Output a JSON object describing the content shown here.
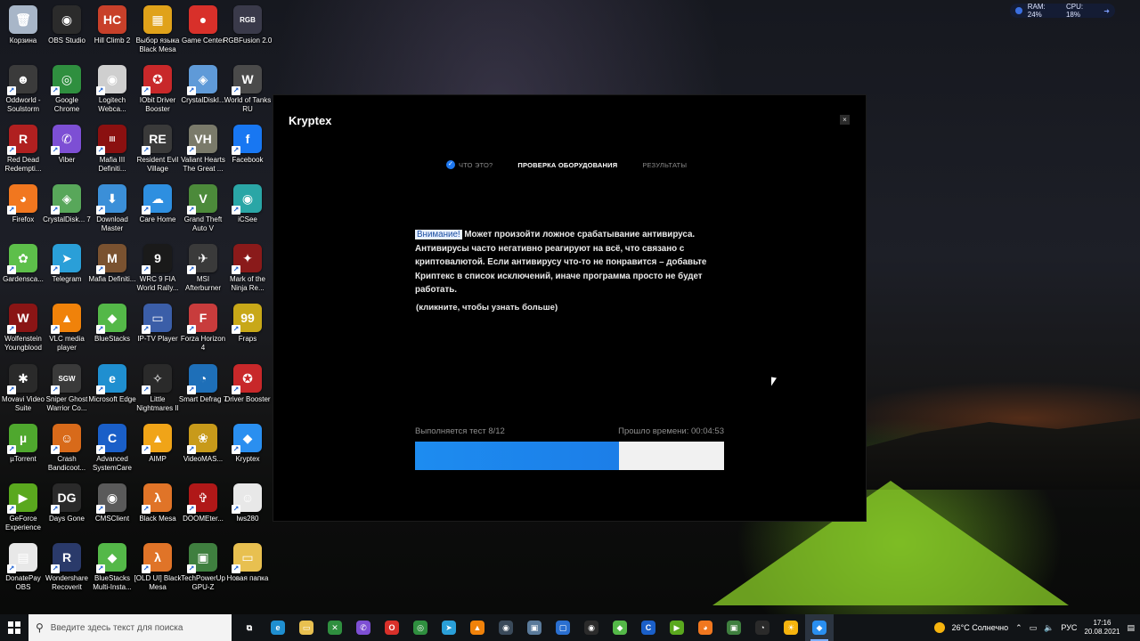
{
  "desktop": {
    "icons": [
      {
        "label": "Корзина",
        "glyph": "🗑",
        "color": "#a8b6c8"
      },
      {
        "label": "OBS Studio",
        "glyph": "◉",
        "color": "#2b2b2b"
      },
      {
        "label": "Hill Climb 2",
        "glyph": "HC",
        "color": "#c8402a"
      },
      {
        "label": "Выбор языка Black Mesa",
        "glyph": "▦",
        "color": "#e0a21a"
      },
      {
        "label": "Game Center",
        "glyph": "●",
        "color": "#d8302a"
      },
      {
        "label": "RGBFusion 2.0",
        "glyph": "RGB",
        "color": "#3a3a4a"
      },
      {
        "label": "Oddworld - Soulstorm",
        "glyph": "☻",
        "color": "#3b3b3b"
      },
      {
        "label": "Google Chrome",
        "glyph": "◎",
        "color": "#2f8f3f"
      },
      {
        "label": "Logitech Webca...",
        "glyph": "◉",
        "color": "#cfcfcf"
      },
      {
        "label": "IObit Driver Booster",
        "glyph": "✪",
        "color": "#c8282a"
      },
      {
        "label": "CrystalDiskI...",
        "glyph": "◈",
        "color": "#5f9ad8"
      },
      {
        "label": "World of Tanks RU",
        "glyph": "W",
        "color": "#4a4a4a"
      },
      {
        "label": "Red Dead Redempti...",
        "glyph": "R",
        "color": "#b02020"
      },
      {
        "label": "Viber",
        "glyph": "✆",
        "color": "#7d4fd4"
      },
      {
        "label": "Mafia III Definiti...",
        "glyph": "III",
        "color": "#8b1010"
      },
      {
        "label": "Resident Evil Village",
        "glyph": "RE",
        "color": "#3a3a3a"
      },
      {
        "label": "Valiant Hearts The Great ...",
        "glyph": "VH",
        "color": "#7a7a6a"
      },
      {
        "label": "Facebook",
        "glyph": "f",
        "color": "#1877f2"
      },
      {
        "label": "Firefox",
        "glyph": "◕",
        "color": "#f1771f"
      },
      {
        "label": "CrystalDisk... 7",
        "glyph": "◈",
        "color": "#58a75a"
      },
      {
        "label": "Download Master",
        "glyph": "⬇",
        "color": "#3b8fd8"
      },
      {
        "label": "Care Home",
        "glyph": "☁",
        "color": "#2e8fe0"
      },
      {
        "label": "Grand Theft Auto V",
        "glyph": "V",
        "color": "#4c8a3a"
      },
      {
        "label": "iCSee",
        "glyph": "◉",
        "color": "#2aa6a6"
      },
      {
        "label": "Gardensca...",
        "glyph": "✿",
        "color": "#5dbf4a"
      },
      {
        "label": "Telegram",
        "glyph": "➤",
        "color": "#2a9fd8"
      },
      {
        "label": "Mafia Definiti...",
        "glyph": "M",
        "color": "#7a5230"
      },
      {
        "label": "WRC 9 FIA World Rally...",
        "glyph": "9",
        "color": "#1a1a1a"
      },
      {
        "label": "MSI Afterburner",
        "glyph": "✈",
        "color": "#3a3a3a"
      },
      {
        "label": "Mark of the Ninja Re...",
        "glyph": "✦",
        "color": "#8a1a1a"
      },
      {
        "label": "Wolfenstein Youngblood",
        "glyph": "W",
        "color": "#8a1515"
      },
      {
        "label": "VLC media player",
        "glyph": "▲",
        "color": "#f0820a"
      },
      {
        "label": "BlueStacks",
        "glyph": "◆",
        "color": "#54b848"
      },
      {
        "label": "IP-TV Player",
        "glyph": "▭",
        "color": "#3b5ea8"
      },
      {
        "label": "Forza Horizon 4",
        "glyph": "F",
        "color": "#c83c3c"
      },
      {
        "label": "Fraps",
        "glyph": "99",
        "color": "#c8a818"
      },
      {
        "label": "Movavi Video Suite",
        "glyph": "✱",
        "color": "#2a2a2a"
      },
      {
        "label": "Sniper Ghost Warrior Co...",
        "glyph": "SGW",
        "color": "#3a3a3a"
      },
      {
        "label": "Microsoft Edge",
        "glyph": "e",
        "color": "#1f8fd0"
      },
      {
        "label": "Little Nightmares II",
        "glyph": "✧",
        "color": "#2a2a2a"
      },
      {
        "label": "Smart Defrag 7",
        "glyph": "◔",
        "color": "#1e6fb8"
      },
      {
        "label": "Driver Booster",
        "glyph": "✪",
        "color": "#c8282a"
      },
      {
        "label": "µTorrent",
        "glyph": "µ",
        "color": "#4fa82e"
      },
      {
        "label": "Crash Bandicoot...",
        "glyph": "☺",
        "color": "#d86a1a"
      },
      {
        "label": "Advanced SystemCare",
        "glyph": "C",
        "color": "#1a5fc8"
      },
      {
        "label": "AIMP",
        "glyph": "▲",
        "color": "#f0a418"
      },
      {
        "label": "VideoMAS...",
        "glyph": "❀",
        "color": "#c89a1a"
      },
      {
        "label": "Kryptex",
        "glyph": "◆",
        "color": "#2a8ff0"
      },
      {
        "label": "GeForce Experience",
        "glyph": "▶",
        "color": "#5aa81e"
      },
      {
        "label": "Days Gone",
        "glyph": "DG",
        "color": "#2a2a2a"
      },
      {
        "label": "CMSClient",
        "glyph": "◉",
        "color": "#5a5a5a"
      },
      {
        "label": "Black Mesa",
        "glyph": "λ",
        "color": "#e07428"
      },
      {
        "label": "DOOMEter...",
        "glyph": "✞",
        "color": "#b01818"
      },
      {
        "label": "lws280",
        "glyph": "☺",
        "color": "#e8e8e8"
      },
      {
        "label": "DonatePay OBS",
        "glyph": "▤",
        "color": "#e8e8e8"
      },
      {
        "label": "Wondershare Recoverit",
        "glyph": "R",
        "color": "#2a3a6a"
      },
      {
        "label": "BlueStacks Multi-Insta...",
        "glyph": "◆",
        "color": "#54b848"
      },
      {
        "label": "[OLD UI] Black Mesa",
        "glyph": "λ",
        "color": "#e07428"
      },
      {
        "label": "TechPowerUp GPU-Z",
        "glyph": "▣",
        "color": "#3f7f3f"
      },
      {
        "label": "Новая папка",
        "glyph": "▭",
        "color": "#e8c050"
      }
    ]
  },
  "sysmon": {
    "ram": "RAM: 24%",
    "cpu": "CPU: 18%"
  },
  "window": {
    "title": "Kryptex",
    "close_glyph": "×",
    "steps": [
      {
        "label": "ЧТО ЭТО?",
        "state": "done"
      },
      {
        "label": "ПРОВЕРКА ОБОРУДОВАНИЯ",
        "state": "active"
      },
      {
        "label": "РЕЗУЛЬТАТЫ",
        "state": "pending"
      }
    ],
    "warning_tag": "Внимание!",
    "warning_text": " Может произойти ложное срабатывание антивируса. Антивирусы часто негативно реагируют на всё, что связано с криптовалютой. Если антивирусу что-то не понравится – добавьте Криптекс в список исключений, иначе программа просто не будет работать.",
    "learn_more": "(кликните, чтобы узнать больше)",
    "progress_label": "Выполняется тест 8/12",
    "elapsed_label": "Прошло времени: 00:04:53",
    "progress_fraction": 0.66
  },
  "taskbar": {
    "search_placeholder": "Введите здесь текст для поиска",
    "apps": [
      {
        "name": "task-view",
        "glyph": "⧉",
        "color": "#111417"
      },
      {
        "name": "edge",
        "glyph": "e",
        "color": "#1f8fd0"
      },
      {
        "name": "explorer",
        "glyph": "▭",
        "color": "#e8c050"
      },
      {
        "name": "xbox",
        "glyph": "✕",
        "color": "#2f8f3f"
      },
      {
        "name": "viber",
        "glyph": "✆",
        "color": "#7d4fd4"
      },
      {
        "name": "opera",
        "glyph": "O",
        "color": "#d8302a"
      },
      {
        "name": "chrome",
        "glyph": "◎",
        "color": "#2f8f3f"
      },
      {
        "name": "telegram",
        "glyph": "➤",
        "color": "#2a9fd8"
      },
      {
        "name": "vlc",
        "glyph": "▲",
        "color": "#f0820a"
      },
      {
        "name": "steam",
        "glyph": "◉",
        "color": "#3a4a5a"
      },
      {
        "name": "pc",
        "glyph": "▣",
        "color": "#5a7a9a"
      },
      {
        "name": "window",
        "glyph": "▢",
        "color": "#2a6fd0"
      },
      {
        "name": "obs",
        "glyph": "◉",
        "color": "#2b2b2b"
      },
      {
        "name": "bluestacks",
        "glyph": "◆",
        "color": "#54b848"
      },
      {
        "name": "advanced-systemcare",
        "glyph": "C",
        "color": "#1a5fc8"
      },
      {
        "name": "nvidia",
        "glyph": "▶",
        "color": "#5aa81e"
      },
      {
        "name": "firefox",
        "glyph": "◕",
        "color": "#f1771f"
      },
      {
        "name": "gpu-z",
        "glyph": "▣",
        "color": "#3f7f3f"
      },
      {
        "name": "snagit",
        "glyph": "◔",
        "color": "#2a2a2a"
      },
      {
        "name": "weather-app",
        "glyph": "☀",
        "color": "#f6b40e"
      },
      {
        "name": "kryptex",
        "glyph": "◆",
        "color": "#2a8ff0",
        "active": true
      }
    ],
    "weather": "26°C  Солнечно",
    "lang": "РУС",
    "time": "17:16",
    "date": "20.08.2021"
  }
}
